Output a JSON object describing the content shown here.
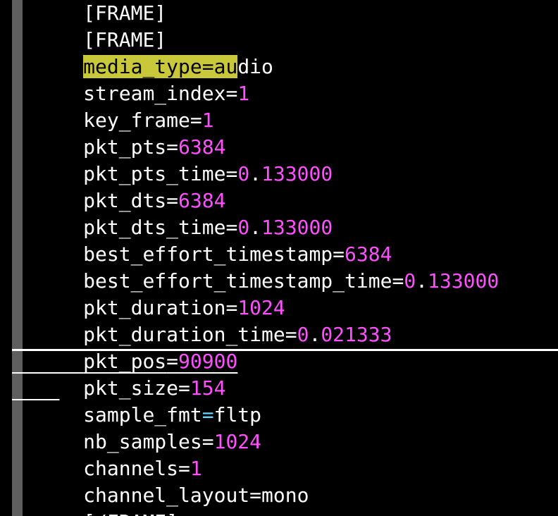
{
  "lines": [
    {
      "key": "[FRAME]",
      "eq": "",
      "value": ""
    },
    {
      "key": "[FRAME]",
      "eq": "",
      "value": ""
    },
    {
      "key_hl": "media_type=au",
      "key_rest": "dio"
    },
    {
      "key": "stream_index",
      "eq": "=",
      "value": "1"
    },
    {
      "key": "key_frame",
      "eq": "=",
      "value": "1"
    },
    {
      "key": "pkt_pts",
      "eq": "=",
      "value": "6384"
    },
    {
      "key": "pkt_pts_time",
      "eq": "=",
      "value_lead": "0",
      "value_dot": ".",
      "value": "133000"
    },
    {
      "key": "pkt_dts",
      "eq": "=",
      "value": "6384"
    },
    {
      "key": "pkt_dts_time",
      "eq": "=",
      "value_lead": "0",
      "value_dot": ".",
      "value": "133000"
    },
    {
      "key": "best_effort_timestamp",
      "eq": "=",
      "value": "6384"
    },
    {
      "key": "best_effort_timestamp_time",
      "eq": "=",
      "value_lead": "0",
      "value_dot": ".",
      "value": "133000"
    },
    {
      "key": "pkt_duration",
      "eq": "=",
      "value": "1024"
    },
    {
      "key": "pkt_duration_time",
      "eq": "=",
      "value_lead": "0",
      "value_dot": ".",
      "value": "021333"
    },
    {
      "key": "pkt_pos",
      "eq": "=",
      "value": "90900"
    },
    {
      "key": "pkt_size",
      "eq": "=",
      "value": "154"
    },
    {
      "key": "sample_fmt",
      "eq": "=",
      "value": "fltp"
    },
    {
      "key": "nb_samples",
      "eq": "=",
      "value": "1024"
    },
    {
      "key": "channels",
      "eq": "=",
      "value": "1"
    },
    {
      "key": "channel_layout",
      "eq": "=",
      "value": "mono"
    },
    {
      "key": "[/FRAME]",
      "eq": "",
      "value": ""
    }
  ],
  "colors": {
    "background": "#000000",
    "gutter": "#5e5e5e",
    "text": "#ffffff",
    "number": "#ff4fff",
    "string": "#5fd7ff",
    "search_highlight": "#c8c83a"
  }
}
